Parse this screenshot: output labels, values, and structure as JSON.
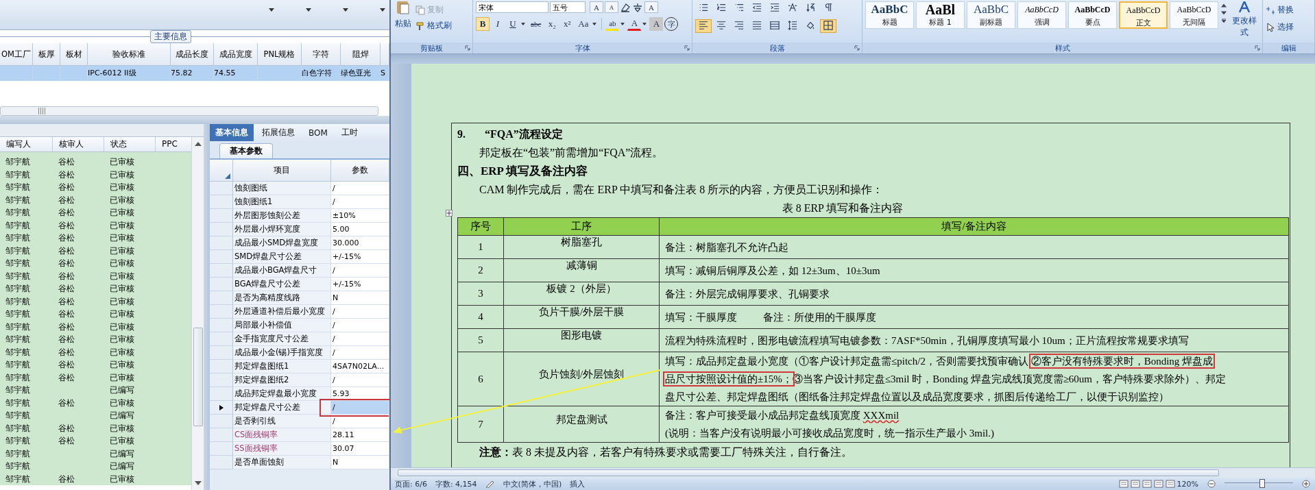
{
  "erp": {
    "main_grid": {
      "section_title": "主要信息",
      "columns": [
        "OM工厂",
        "板厚",
        "板材",
        "验收标准",
        "成品长度",
        "成品宽度",
        "PNL规格",
        "字符",
        "阻焊"
      ],
      "rows": [
        {
          "selected": true,
          "cells": [
            null,
            null,
            null,
            "IPC-6012 II级",
            "75.82",
            "74.55",
            null,
            "白色字符",
            "绿色亚光",
            "S"
          ]
        }
      ]
    },
    "list": {
      "columns": [
        "编写人",
        "核审人",
        "状态",
        "PPC"
      ],
      "rows": [
        {
          "writer": "邹宇航",
          "reviewer": "谷松",
          "status": "已审核"
        },
        {
          "writer": "邹宇航",
          "reviewer": "谷松",
          "status": "已审核"
        },
        {
          "writer": "邹宇航",
          "reviewer": "谷松",
          "status": "已审核"
        },
        {
          "writer": "邹宇航",
          "reviewer": "谷松",
          "status": "已审核"
        },
        {
          "writer": "邹宇航",
          "reviewer": "谷松",
          "status": "已审核"
        },
        {
          "writer": "邹宇航",
          "reviewer": "谷松",
          "status": "已审核"
        },
        {
          "writer": "邹宇航",
          "reviewer": "谷松",
          "status": "已审核"
        },
        {
          "writer": "邹宇航",
          "reviewer": "谷松",
          "status": "已审核"
        },
        {
          "writer": "邹宇航",
          "reviewer": "谷松",
          "status": "已审核"
        },
        {
          "writer": "邹宇航",
          "reviewer": "谷松",
          "status": "已审核"
        },
        {
          "writer": "邹宇航",
          "reviewer": "谷松",
          "status": "已审核"
        },
        {
          "writer": "邹宇航",
          "reviewer": "谷松",
          "status": "已审核"
        },
        {
          "writer": "邹宇航",
          "reviewer": "谷松",
          "status": "已审核"
        },
        {
          "writer": "邹宇航",
          "reviewer": "谷松",
          "status": "已审核"
        },
        {
          "writer": "邹宇航",
          "reviewer": "谷松",
          "status": "已审核"
        },
        {
          "writer": "邹宇航",
          "reviewer": "谷松",
          "status": "已审核"
        },
        {
          "writer": "邹宇航",
          "reviewer": "谷松",
          "status": "已审核"
        },
        {
          "writer": "邹宇航",
          "reviewer": "谷松",
          "status": "已审核"
        },
        {
          "writer": "邹宇航",
          "status": "已编写"
        },
        {
          "writer": "邹宇航",
          "reviewer": "谷松",
          "status": "已审核"
        },
        {
          "writer": "邹宇航",
          "status": "已编写"
        },
        {
          "writer": "邹宇航",
          "reviewer": "谷松",
          "status": "已审核"
        },
        {
          "writer": "邹宇航",
          "reviewer": "谷松",
          "status": "已审核"
        },
        {
          "writer": "邹宇航",
          "status": "已编写"
        },
        {
          "writer": "邹宇航",
          "status": "已编写"
        },
        {
          "writer": "邹宇航",
          "reviewer": "谷松",
          "status": "已审核"
        }
      ]
    },
    "panel": {
      "tabs": [
        {
          "label": "基本信息",
          "selected": true
        },
        {
          "label": "拓展信息",
          "selected": false
        },
        {
          "label": "BOM",
          "selected": false
        },
        {
          "label": "工时",
          "selected": false
        }
      ],
      "subtab": "基本参数",
      "grid": {
        "columns": [
          "项目",
          "参数"
        ],
        "rows": [
          {
            "item": "蚀刻图纸",
            "value": "/",
            "selected": false,
            "boxed": false
          },
          {
            "item": "蚀刻图纸1",
            "value": "/",
            "selected": false,
            "boxed": false
          },
          {
            "item": "外层图形蚀刻公差",
            "value": "±10%",
            "selected": false,
            "boxed": false
          },
          {
            "item": "外层最小焊环宽度",
            "value": "5.00",
            "selected": false,
            "boxed": false
          },
          {
            "item": "成品最小SMD焊盘宽度",
            "value": "30.000",
            "selected": false,
            "boxed": false
          },
          {
            "item": "SMD焊盘尺寸公差",
            "value": "+/-15%",
            "selected": false,
            "boxed": false
          },
          {
            "item": "成品最小BGA焊盘尺寸",
            "value": "/",
            "selected": false,
            "boxed": false
          },
          {
            "item": "BGA焊盘尺寸公差",
            "value": "+/-15%",
            "selected": false,
            "boxed": false
          },
          {
            "item": "是否为高精度线路",
            "value": "N",
            "selected": false,
            "boxed": false
          },
          {
            "item": "外层通道补偿后最小宽度",
            "value": "/",
            "selected": false,
            "boxed": false
          },
          {
            "item": "局部最小补偿值",
            "value": "/",
            "selected": false,
            "boxed": false
          },
          {
            "item": "金手指宽度尺寸公差",
            "value": "/",
            "selected": false,
            "boxed": false
          },
          {
            "item": "成品最小金(锡)手指宽度",
            "value": "/",
            "selected": false,
            "boxed": false
          },
          {
            "item": "邦定焊盘图纸1",
            "value": "4SA7N02LA...",
            "selected": false,
            "boxed": false
          },
          {
            "item": "邦定焊盘图纸2",
            "value": "/",
            "selected": false,
            "boxed": false
          },
          {
            "item": "成品邦定焊盘最小宽度",
            "value": "5.93",
            "selected": false,
            "boxed": false
          },
          {
            "item": "邦定焊盘尺寸公差",
            "value": "/",
            "selected": true,
            "boxed": true
          },
          {
            "item": "是否剥引线",
            "value": "/",
            "selected": false,
            "boxed": false
          },
          {
            "item": "CS面残铜率",
            "value": "28.11",
            "color": "#a23b72",
            "selected": false,
            "boxed": false
          },
          {
            "item": "SS面残铜率",
            "value": "30.07",
            "color": "#a23b72",
            "selected": false,
            "boxed": false
          },
          {
            "item": "是否单面蚀刻",
            "value": "N",
            "selected": false,
            "boxed": false
          }
        ]
      }
    }
  },
  "word": {
    "ribbon": {
      "clipboard": {
        "label": "剪贴板",
        "paste": "粘贴",
        "copy": {
          "label": "复制",
          "disabled": true
        },
        "format_painter": {
          "label": "格式刷",
          "disabled": false
        }
      },
      "font": {
        "label": "字体",
        "font_name": "宋体",
        "font_size": "五号",
        "row1": [
          {
            "kind": "grow",
            "label": "A"
          },
          {
            "kind": "shrink",
            "label": "A"
          },
          {
            "kind": "clear"
          },
          {
            "kind": "phonetic"
          },
          {
            "kind": "char-border",
            "label": "A"
          }
        ],
        "row2": [
          {
            "kind": "bold",
            "label": "B"
          },
          {
            "kind": "italic",
            "label": "I"
          },
          {
            "kind": "underline",
            "label": "U"
          },
          {
            "kind": "strike",
            "label": "abc"
          },
          {
            "kind": "subscript",
            "label": "x₂"
          },
          {
            "kind": "superscript",
            "label": "x²"
          },
          {
            "kind": "case",
            "label": "Aa"
          },
          {
            "kind": "highlight",
            "label": "ab"
          },
          {
            "kind": "font-color",
            "label": "A"
          },
          {
            "kind": "shading",
            "label": "A"
          },
          {
            "kind": "enclose",
            "label": "字"
          }
        ]
      },
      "paragraph": {
        "label": "段落",
        "row1": [
          {
            "kind": "bullets",
            "selected": false
          },
          {
            "kind": "numbering",
            "selected": false
          },
          {
            "kind": "multilevel",
            "selected": false
          },
          {
            "kind": "decrease-indent",
            "selected": false
          },
          {
            "kind": "increase-indent",
            "selected": false
          },
          {
            "kind": "chinese-layout",
            "selected": false
          },
          {
            "kind": "sort",
            "selected": false
          },
          {
            "kind": "show-marks",
            "selected": false
          }
        ],
        "row2": [
          {
            "kind": "align-left",
            "selected": true
          },
          {
            "kind": "align-center",
            "selected": false
          },
          {
            "kind": "align-right",
            "selected": false
          },
          {
            "kind": "justify",
            "selected": false
          },
          {
            "kind": "distribute",
            "selected": false
          },
          {
            "kind": "line-spacing",
            "selected": false
          },
          {
            "kind": "shading",
            "selected": false
          },
          {
            "kind": "borders",
            "selected": true
          }
        ]
      },
      "styles": {
        "label": "样式",
        "items": [
          {
            "kind": "heading",
            "preview": "AaBbC",
            "name": "标题",
            "selected": false
          },
          {
            "kind": "title",
            "preview": "AaBl",
            "name": "标题 1",
            "selected": false
          },
          {
            "kind": "subtitle",
            "preview": "AaBbC",
            "name": "副标题",
            "selected": false
          },
          {
            "kind": "emphasis",
            "preview": "AaBbCcD",
            "name": "强调",
            "selected": false
          },
          {
            "kind": "strong",
            "preview": "AaBbCcD",
            "name": "要点",
            "selected": false
          },
          {
            "kind": "normal",
            "preview": "AaBbCcD",
            "name": "正文",
            "selected": true
          },
          {
            "kind": "normal",
            "preview": "AaBbCcD",
            "name": "无间隔",
            "selected": false
          }
        ],
        "change_styles": "更改样式"
      },
      "editing": {
        "label": "编辑",
        "replace": "替换",
        "select": "选择"
      }
    },
    "document": {
      "blocks": [
        {
          "kind": "numbered-heading",
          "number": "9.",
          "text": "“FQA”流程设定"
        },
        {
          "kind": "body",
          "text": "邦定板在“包装”前需增加“FQA”流程。"
        },
        {
          "kind": "heading",
          "text": "四、ERP 填写及备注内容"
        },
        {
          "kind": "body",
          "text": "CAM 制作完成后，需在 ERP 中填写和备注表 8 所示的内容，方便员工识别和操作："
        },
        {
          "kind": "caption",
          "text": "表 8 ERP 填写和备注内容"
        },
        {
          "kind": "table",
          "columns": [
            "序号",
            "工序",
            "填写/备注内容"
          ],
          "rows": [
            {
              "no": "1",
              "process": "树脂塞孔",
              "lines": [
                [
                  {
                    "text": "备注：树脂塞孔不允许凸起",
                    "kind": "plain"
                  }
                ]
              ]
            },
            {
              "no": "2",
              "process": "减薄铜",
              "lines": [
                [
                  {
                    "text": "填写：减铜后铜厚及公差，如 12±3um、10±3um",
                    "kind": "plain"
                  }
                ]
              ]
            },
            {
              "no": "3",
              "process": "板镀 2（外层）",
              "lines": [
                [
                  {
                    "text": "备注：外层完成铜厚要求、孔铜要求",
                    "kind": "plain"
                  }
                ]
              ]
            },
            {
              "no": "4",
              "process": "负片干膜/外层干膜",
              "lines": [
                [
                  {
                    "text": "填写：干膜厚度          备注：所使用的干膜厚度",
                    "kind": "plain"
                  }
                ]
              ]
            },
            {
              "no": "5",
              "process": "图形电镀",
              "lines": [
                [
                  {
                    "text": "流程为特殊流程时，图形电镀流程填写电镀参数：7ASF*50min，孔铜厚度填写最小 10um；正片流程按常规要求填写",
                    "kind": "plain"
                  }
                ]
              ]
            },
            {
              "no": "6",
              "process": "负片蚀刻/外层蚀刻",
              "lines": [
                [
                  {
                    "text": "填写：成品邦定盘最小宽度（①客户设计邦定盘需≤pitch/2，否则需要找预审确认 ",
                    "kind": "plain"
                  },
                  {
                    "text": "②客户没有特殊要求时，Bonding 焊盘成",
                    "kind": "boxed"
                  }
                ],
                [
                  {
                    "text": "品尺寸按照设计值的±15%；",
                    "kind": "boxed"
                  },
                  {
                    "text": "③当客户设计邦定盘≤3mil 时，Bonding 焊盘完成线顶宽度需≥60um，客户特殊要求除外）、邦定",
                    "kind": "plain"
                  }
                ],
                [
                  {
                    "text": "盘尺寸公差、邦定焊盘图纸（图纸备注邦定焊盘位置以及成品宽度要求，抓图后传递给工厂，以便于识别监控）",
                    "kind": "plain"
                  }
                ]
              ]
            },
            {
              "no": "7",
              "process": "邦定盘测试",
              "lines": [
                [
                  {
                    "text": "备注：客户可接受最小成品邦定盘线顶宽度 ",
                    "kind": "plain"
                  },
                  {
                    "text": "XXXmil",
                    "kind": "misspelled"
                  }
                ],
                [
                  {
                    "text": "(说明：当客户没有说明最小可接收成品宽度时，统一指示生产最小 3mil.)",
                    "kind": "plain"
                  }
                ]
              ]
            }
          ]
        },
        {
          "kind": "note",
          "text": "**注意：**表 8 未提及内容，若客户有特殊要求或需要工厂特殊关注，自行备注。"
        }
      ]
    },
    "status_bar": {
      "page": "页面: 6/6",
      "words": "字数: 4,154",
      "language": "中文(简体，中国)",
      "mode": "插入",
      "zoom": "120%",
      "zoom_slider": {
        "level": 0.55
      }
    }
  }
}
